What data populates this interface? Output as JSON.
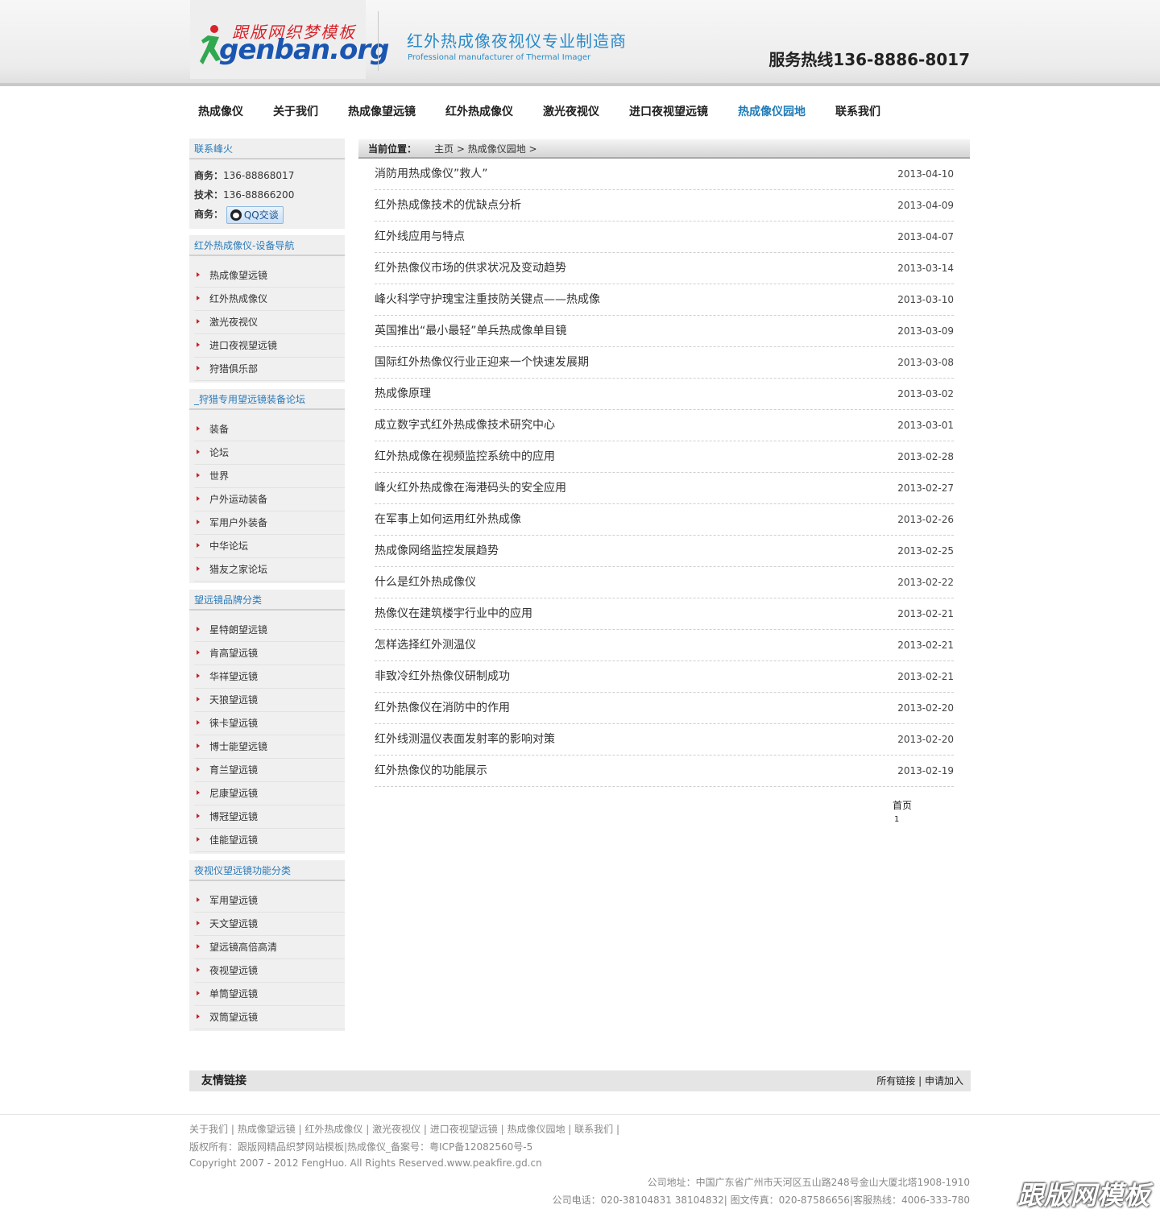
{
  "header": {
    "logo_top": "跟版网织梦模板",
    "logo_main": "genban.org",
    "slogan_cn": "红外热成像夜视仪专业制造商",
    "slogan_en": "Professional manufacturer of Thermal Imager",
    "hotline": "服务热线136-8886-8017"
  },
  "nav": {
    "items": [
      {
        "label": "热成像仪"
      },
      {
        "label": "关于我们"
      },
      {
        "label": "热成像望远镜"
      },
      {
        "label": "红外热成像仪"
      },
      {
        "label": "激光夜视仪"
      },
      {
        "label": "进口夜视望远镜"
      },
      {
        "label": "热成像仪园地"
      },
      {
        "label": "联系我们"
      }
    ],
    "active_index": 6
  },
  "sidebar": {
    "contact": {
      "title": "联系峰火",
      "business_label": "商务：",
      "business_phone": "136-88868017",
      "tech_label": "技术：",
      "tech_phone": "136-88866200",
      "qq_label": "商务：",
      "qq_button": "QQ交谈"
    },
    "blocks": [
      {
        "title": "红外热成像仪-设备导航",
        "items": [
          "热成像望远镜",
          "红外热成像仪",
          "激光夜视仪",
          "进口夜视望远镜",
          "狩猎俱乐部"
        ]
      },
      {
        "title": "_狩猎专用望远镜装备论坛",
        "items": [
          "装备",
          "论坛",
          "世界",
          "户外运动装备",
          "军用户外装备",
          "中华论坛",
          "猎友之家论坛"
        ]
      },
      {
        "title": "望远镜品牌分类",
        "items": [
          "星特朗望远镜",
          "肯高望远镜",
          "华祥望远镜",
          "天狼望远镜",
          "徕卡望远镜",
          "博士能望远镜",
          "育兰望远镜",
          "尼康望远镜",
          "博冠望远镜",
          "佳能望远镜"
        ]
      },
      {
        "title": "夜视仪望远镜功能分类",
        "items": [
          "军用望远镜",
          "天文望远镜",
          "望远镜高倍高清",
          "夜视望远镜",
          "单筒望远镜",
          "双筒望远镜"
        ]
      }
    ]
  },
  "breadcrumb": {
    "label": "当前位置：",
    "home": "主页",
    "sep1": " > ",
    "current": "热成像仪园地",
    "sep2": " >"
  },
  "news": [
    {
      "title": "消防用热成像仪”救人”",
      "date": "2013-04-10"
    },
    {
      "title": "红外热成像技术的优缺点分析",
      "date": "2013-04-09"
    },
    {
      "title": "红外线应用与特点",
      "date": "2013-04-07"
    },
    {
      "title": "红外热像仪市场的供求状况及变动趋势",
      "date": "2013-03-14"
    },
    {
      "title": "峰火科学守护瑰宝注重技防关键点——热成像",
      "date": "2013-03-10"
    },
    {
      "title": "英国推出“最小最轻”单兵热成像单目镜",
      "date": "2013-03-09"
    },
    {
      "title": "国际红外热像仪行业正迎来一个快速发展期",
      "date": "2013-03-08"
    },
    {
      "title": "热成像原理",
      "date": "2013-03-02"
    },
    {
      "title": "成立数字式红外热成像技术研究中心",
      "date": "2013-03-01"
    },
    {
      "title": "红外热成像在视频监控系统中的应用",
      "date": "2013-02-28"
    },
    {
      "title": "峰火红外热成像在海港码头的安全应用",
      "date": "2013-02-27"
    },
    {
      "title": "在军事上如何运用红外热成像",
      "date": "2013-02-26"
    },
    {
      "title": "热成像网络监控发展趋势",
      "date": "2013-02-25"
    },
    {
      "title": "什么是红外热成像仪",
      "date": "2013-02-22"
    },
    {
      "title": "热像仪在建筑楼宇行业中的应用",
      "date": "2013-02-21"
    },
    {
      "title": "怎样选择红外测温仪",
      "date": "2013-02-21"
    },
    {
      "title": "非致冷红外热像仪研制成功",
      "date": "2013-02-21"
    },
    {
      "title": "红外热像仪在消防中的作用",
      "date": "2013-02-20"
    },
    {
      "title": "红外线测温仪表面发射率的影响对策",
      "date": "2013-02-20"
    },
    {
      "title": "红外热像仪的功能展示",
      "date": "2013-02-19"
    }
  ],
  "pager": {
    "first": "首页",
    "page": "1"
  },
  "friend_links": {
    "title": "友情链接",
    "all": "所有链接",
    "sep": " | ",
    "apply": "申请加入"
  },
  "footer": {
    "links": [
      "关于我们",
      "热成像望远镜",
      "红外热成像仪",
      "激光夜视仪",
      "进口夜视望远镜",
      "热成像仪园地",
      "联系我们"
    ],
    "copyright": "版权所有：跟版网精品织梦网站模板|热成像仪_备案号：粤ICP备12082560号-5",
    "copyright_en": "Copyright 2007 - 2012 FengHuo. All Rights Reserved.www.peakfire.gd.cn",
    "address": "公司地址：中国广东省广州市天河区五山路248号金山大厦北塔1908-1910",
    "phones": "公司电话：020-38104831 38104832| 图文传真：020-87586656|客服热线：4006-333-780",
    "watermark": "跟版网模板"
  }
}
